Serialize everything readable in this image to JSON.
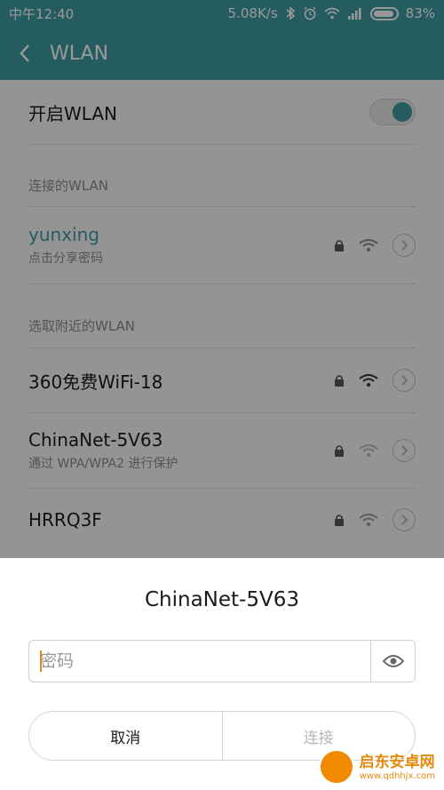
{
  "status_bar": {
    "time": "中午12:40",
    "speed": "5.08K/s",
    "battery": "83%",
    "icons": [
      "bluetooth-icon",
      "alarm-icon",
      "wifi-icon",
      "signal-icon",
      "battery-icon"
    ]
  },
  "header": {
    "title": "WLAN"
  },
  "wlan_toggle": {
    "label": "开启WLAN",
    "on": true
  },
  "connected": {
    "section_label": "连接的WLAN",
    "network": {
      "name": "yunxing",
      "sub": "点击分享密码"
    }
  },
  "nearby": {
    "section_label": "选取附近的WLAN",
    "networks": [
      {
        "name": "360免费WiFi-18",
        "sub": ""
      },
      {
        "name": "ChinaNet-5V63",
        "sub": "通过 WPA/WPA2 进行保护"
      },
      {
        "name": "HRRQ3F",
        "sub": ""
      }
    ]
  },
  "dialog": {
    "title": "ChinaNet-5V63",
    "password_placeholder": "密码",
    "cancel_label": "取消",
    "connect_label": "连接"
  },
  "watermark": {
    "text": "启东安卓网",
    "url": "www.qdhhjx.com"
  },
  "colors": {
    "accent": "#3d9aa0",
    "caret": "#e08a23"
  }
}
